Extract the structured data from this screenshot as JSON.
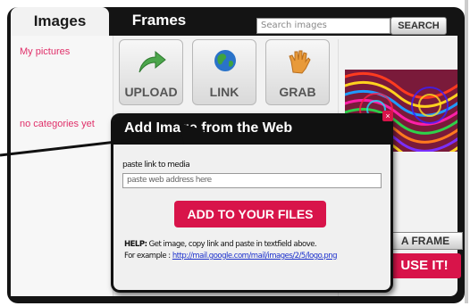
{
  "tabs": {
    "images": "Images",
    "frames": "Frames"
  },
  "search": {
    "placeholder": "Search images",
    "button": "SEARCH"
  },
  "sidebar": {
    "my_pictures": "My pictures",
    "no_categories": "no categories yet"
  },
  "tools": [
    {
      "label": "UPLOAD",
      "icon": "green-arrow-icon"
    },
    {
      "label": "LINK",
      "icon": "globe-icon"
    },
    {
      "label": "GRAB",
      "icon": "hand-icon"
    }
  ],
  "right_panel": {
    "add_frame": "A FRAME",
    "use_it": "USE IT!"
  },
  "dialog": {
    "title": "Add Image from the Web",
    "paste_label": "paste link to media",
    "url_value": "paste web address here",
    "add_button": "ADD TO YOUR FILES",
    "help_label": "HELP:",
    "help_text": "Get image, copy link and paste in textfield above.",
    "example_label": "For example :",
    "example_link": "http://mail.google.com/mail/images/2/5/logo.png"
  },
  "colors": {
    "accent": "#d8144a",
    "sidebar_link": "#e0306a",
    "dark": "#141414"
  }
}
